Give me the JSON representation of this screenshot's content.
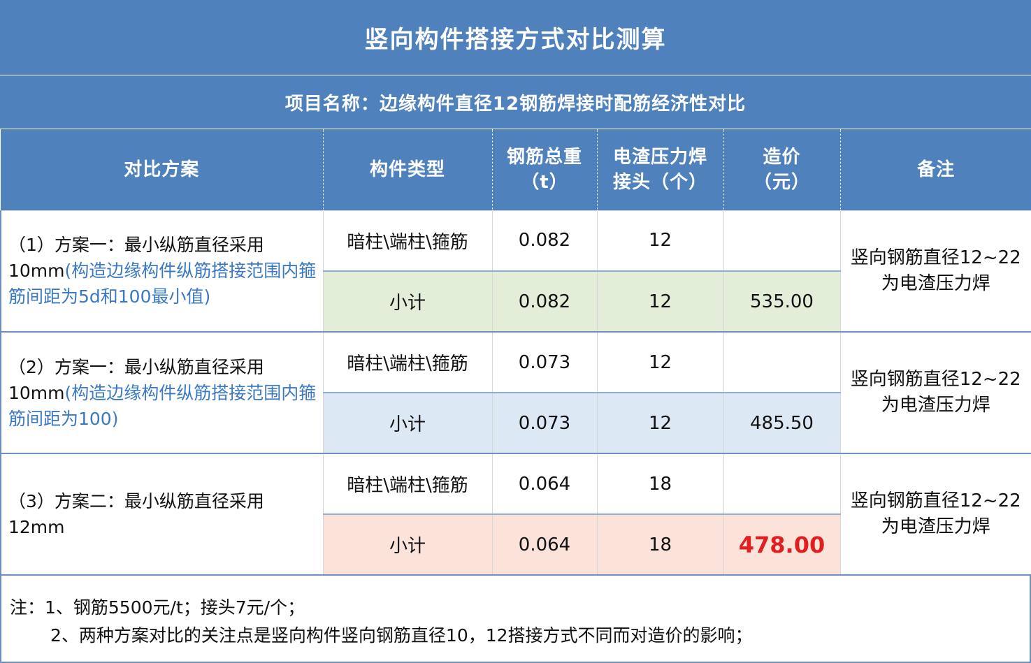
{
  "title": "竖向构件搭接方式对比测算",
  "project": "项目名称：边缘构件直径12钢筋焊接时配筋经济性对比",
  "headers": {
    "plan": "对比方案",
    "type": "构件类型",
    "weight_l1": "钢筋总重",
    "weight_l2": "（t）",
    "joints_l1": "电渣压力焊",
    "joints_l2": "接头（个）",
    "price_l1": "造价",
    "price_l2": "（元）",
    "remark": "备注"
  },
  "rows": [
    {
      "plan_prefix": "（1）方案一：最小纵筋直径采用10mm",
      "plan_note": "(构造边缘构件纵筋搭接范围内箍筋间距为5d和100最小值)",
      "type": "暗柱\\端柱\\箍筋",
      "weight": "0.082",
      "joints": "12",
      "subtotal_label": "小计",
      "subtotal_weight": "0.082",
      "subtotal_joints": "12",
      "subtotal_price": "535.00",
      "remark_l1": "竖向钢筋直径12~22",
      "remark_l2": "为电渣压力焊",
      "subtotal_bg": "#e3eed8"
    },
    {
      "plan_prefix": "（2）方案一：最小纵筋直径采用10mm",
      "plan_note": "(构造边缘构件纵筋搭接范围内箍筋间距为100)",
      "type": "暗柱\\端柱\\箍筋",
      "weight": "0.073",
      "joints": "12",
      "subtotal_label": "小计",
      "subtotal_weight": "0.073",
      "subtotal_joints": "12",
      "subtotal_price": "485.50",
      "remark_l1": "竖向钢筋直径12~22",
      "remark_l2": "为电渣压力焊",
      "subtotal_bg": "#dde8f5"
    },
    {
      "plan_prefix": "（3）方案二：最小纵筋直径采用12mm",
      "plan_note": "",
      "type": "暗柱\\端柱\\箍筋",
      "weight": "0.064",
      "joints": "18",
      "subtotal_label": "小计",
      "subtotal_weight": "0.064",
      "subtotal_joints": "18",
      "subtotal_price": "478.00",
      "remark_l1": "竖向钢筋直径12~22",
      "remark_l2": "为电渣压力焊",
      "subtotal_bg": "#fbe3d9"
    }
  ],
  "notes": {
    "line1": "注：1、钢筋5500元/t；接头7元/个；",
    "line2": "2、两种方案对比的关注点是竖向构件竖向钢筋直径10，12搭接方式不同而对造价的影响；"
  },
  "colors": {
    "header_bg": "#4f81bd",
    "highlight_text": "#3b78c3",
    "best_price": "#e02020"
  }
}
